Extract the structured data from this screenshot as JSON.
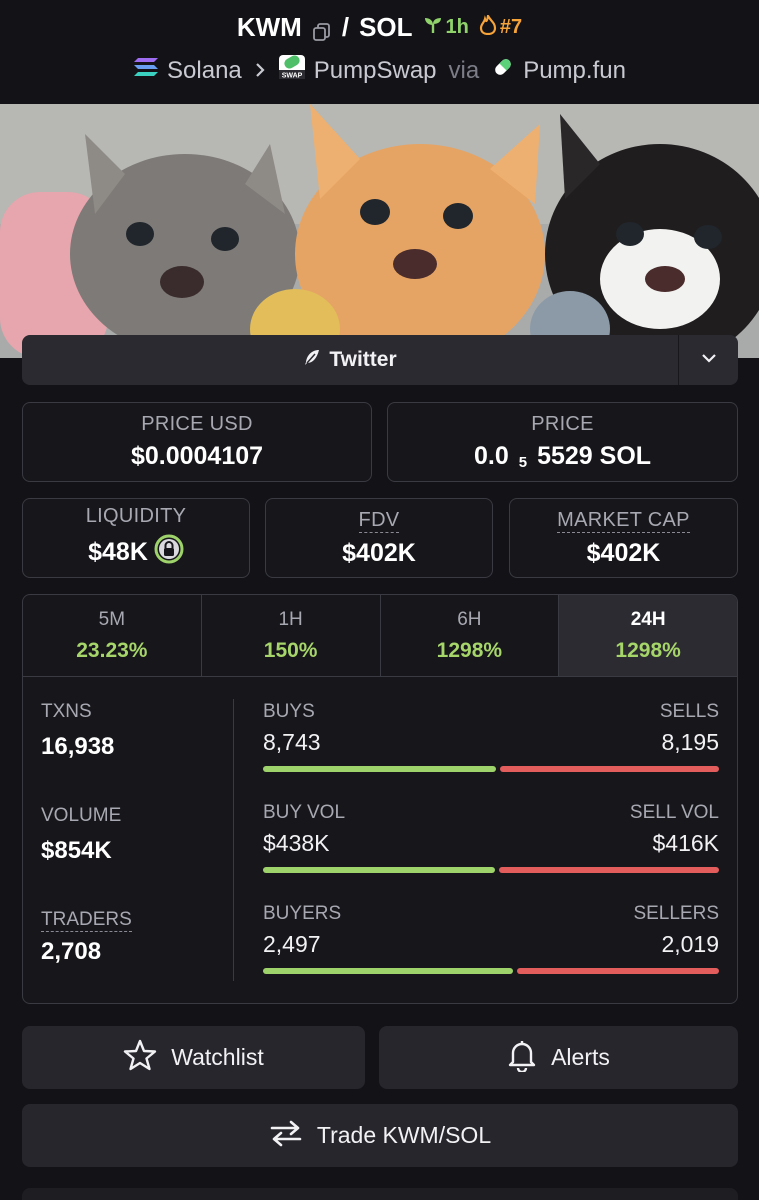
{
  "header": {
    "base_token": "KWM",
    "separator": "/",
    "quote_token": "SOL",
    "age": "1h",
    "rank": "#7",
    "chain": "Solana",
    "dex": "PumpSwap",
    "via": "via",
    "launchpad": "Pump.fun",
    "swap_badge": "SWAP"
  },
  "social": {
    "twitter_label": "Twitter"
  },
  "prices": {
    "price_usd_label": "PRICE USD",
    "price_usd": "$0.0004107",
    "price_label": "PRICE",
    "price_prefix": "0.0",
    "price_sub": "5",
    "price_suffix": "5529 SOL"
  },
  "metrics": {
    "liquidity_label": "LIQUIDITY",
    "liquidity": "$48K",
    "fdv_label": "FDV",
    "fdv": "$402K",
    "mcap_label": "MARKET CAP",
    "mcap": "$402K"
  },
  "tabs": [
    {
      "label": "5M",
      "value": "23.23%"
    },
    {
      "label": "1H",
      "value": "150%"
    },
    {
      "label": "6H",
      "value": "1298%"
    },
    {
      "label": "24H",
      "value": "1298%"
    }
  ],
  "stats": {
    "txns_label": "TXNS",
    "txns": "16,938",
    "volume_label": "VOLUME",
    "volume": "$854K",
    "traders_label": "TRADERS",
    "traders": "2,708",
    "buys_label": "BUYS",
    "buys": "8,743",
    "sells_label": "SELLS",
    "sells": "8,195",
    "buy_vol_label": "BUY VOL",
    "buy_vol": "$438K",
    "sell_vol_label": "SELL VOL",
    "sell_vol": "$416K",
    "buyers_label": "BUYERS",
    "buyers": "2,497",
    "sellers_label": "SELLERS",
    "sellers": "2,019",
    "buys_share": 0.516,
    "buy_vol_share": 0.513,
    "buyers_share": 0.553
  },
  "actions": {
    "watchlist": "Watchlist",
    "alerts": "Alerts",
    "trade": "Trade KWM/SOL"
  },
  "colors": {
    "accent_green": "#9ed26a",
    "accent_red": "#e35d5d",
    "rank_orange": "#f6a33a"
  }
}
